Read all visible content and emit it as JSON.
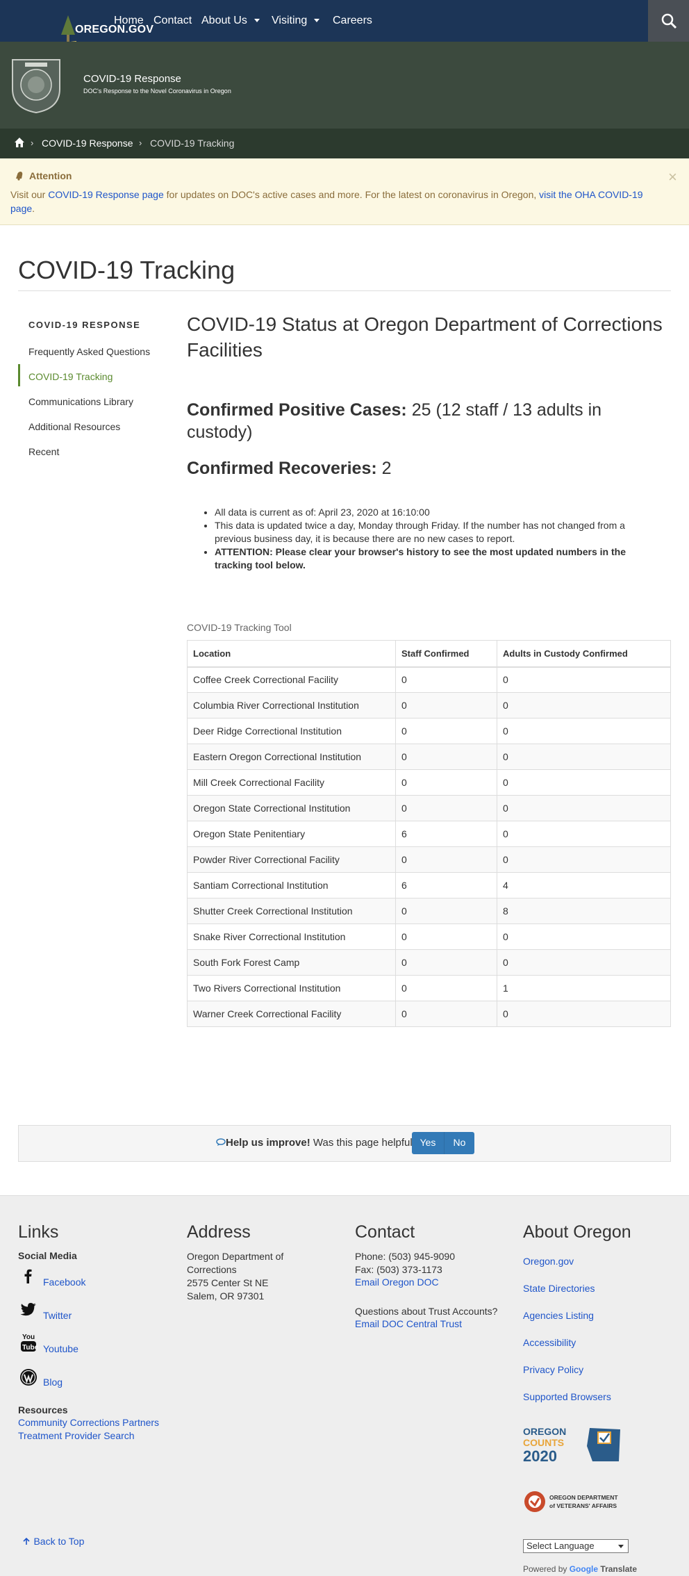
{
  "topnav": {
    "logo": "OREGON.GOV",
    "items": [
      "Home",
      "Contact",
      "About Us",
      "Visiting",
      "Careers"
    ]
  },
  "header": {
    "title": "COVID-19 Response",
    "subtitle": "DOC's Response to the Novel Coronavirus in Oregon",
    "seal_text": "OREGON DEPARTMENT OF CORRECTIONS"
  },
  "breadcrumb": {
    "items": [
      "COVID-19 Response",
      "COVID-19 Tracking"
    ],
    "separator": "›"
  },
  "alert": {
    "title": "Attention",
    "body_pre": "Visit our ",
    "link1": "COVID-19 Response page",
    "body_mid": " for updates on DOC's active cases and more. For the latest on coronavirus in Oregon, ",
    "link2": "visit the OHA COVID-19 page",
    "body_post": ".",
    "close": "×"
  },
  "page": {
    "title": "COVID-19 Tracking"
  },
  "sidebar": {
    "heading": "COVID-19 RESPONSE",
    "items": [
      {
        "label": "Frequently Asked Questions"
      },
      {
        "label": "COVID-19 Tracking"
      },
      {
        "label": "Communications Library"
      },
      {
        "label": "Additional Resources"
      },
      {
        "label": "Recent"
      }
    ]
  },
  "main": {
    "heading": "COVID-19 Status at Oregon Department of Corrections Facilities",
    "positive_label": "Confirmed Positive Cases:",
    "positive_value": "25 (12 staff / 13 adults in custody)",
    "recoveries_label": "Confirmed Recoveries:",
    "recoveries_value": "2",
    "notes": [
      "All data is current as of: April 23, 2020 at 16:10:00",
      "This data is updated twice a day, Monday through Friday. If the number has not changed from a previous business day, it is because there are no new cases to report."
    ],
    "attention_note": "ATTENTION: Please clear your browser's history to see the most updated numbers in the tracking tool below."
  },
  "table": {
    "caption": "COVID-19 Tracking Tool",
    "headers": [
      "Location",
      "Staff Confirmed",
      "Adults in Custody Confirmed"
    ],
    "rows": [
      [
        "Coffee Creek Correctional Facility",
        "0",
        "0"
      ],
      [
        "Columbia River Correctional Institution",
        "0",
        "0"
      ],
      [
        "Deer Ridge Correctional Institution",
        "0",
        "0"
      ],
      [
        "Eastern Oregon Correctional Institution",
        "0",
        "0"
      ],
      [
        "Mill Creek Correctional Facility",
        "0",
        "0"
      ],
      [
        "Oregon State Correctional Institution",
        "0",
        "0"
      ],
      [
        "Oregon State Penitentiary",
        "6",
        "0"
      ],
      [
        "Powder River Correctional Facility",
        "0",
        "0"
      ],
      [
        "Santiam Correctional Institution",
        "6",
        "4"
      ],
      [
        "Shutter Creek Correctional Institution",
        "0",
        "8"
      ],
      [
        "Snake River Correctional Institution",
        "0",
        "0"
      ],
      [
        "South Fork Forest Camp",
        "0",
        "0"
      ],
      [
        "Two Rivers Correctional Institution",
        "0",
        "1"
      ],
      [
        "Warner Creek Correctional Facility",
        "0",
        "0"
      ]
    ]
  },
  "feedback": {
    "bold": "Help us improve!",
    "question": " Was this page helpful?",
    "yes": "Yes",
    "no": "No"
  },
  "footer": {
    "links_heading": "Links",
    "social_heading": "Social Media",
    "social": [
      "Facebook",
      "Twitter",
      "Youtube",
      "Blog"
    ],
    "resources_heading": "Resources",
    "resources": [
      "Community Corrections Partners",
      "Treatment Provider Search"
    ],
    "address_heading": "Address",
    "address_lines": [
      "Oregon Department of",
      "Corrections",
      "2575 Center St NE",
      "Salem, OR 97301"
    ],
    "contact_heading": "Contact",
    "phone": "Phone: (503) 945-9090",
    "fax": "Fax: (503) 373-1173",
    "email_doc": "Email Oregon DOC",
    "trust_q": "Questions about Trust Accounts?",
    "email_trust": "Email DOC Central Trust",
    "about_heading": "About Oregon",
    "about_links": [
      "Oregon.gov",
      "State Directories",
      "Agencies Listing",
      "Accessibility",
      "Privacy Policy",
      "Supported Browsers"
    ],
    "oregon_counts_1": "OREGON",
    "oregon_counts_2": "COUNTS",
    "oregon_counts_3": "2020",
    "veterans_1": "OREGON DEPARTMENT",
    "veterans_2": "of VETERANS' AFFAIRS",
    "back_to_top": "Back to Top",
    "language": "Select Language",
    "powered_by": "Powered by",
    "google": "Google",
    "translate": "Translate"
  },
  "colors": {
    "topnav": "#1c3557",
    "header": "#3c4a3e",
    "breadcrumb": "#2c3a2e",
    "alert_bg": "#fcf8e3",
    "link": "#1f55c9",
    "active": "#5a8a2e",
    "button": "#337ab7"
  }
}
